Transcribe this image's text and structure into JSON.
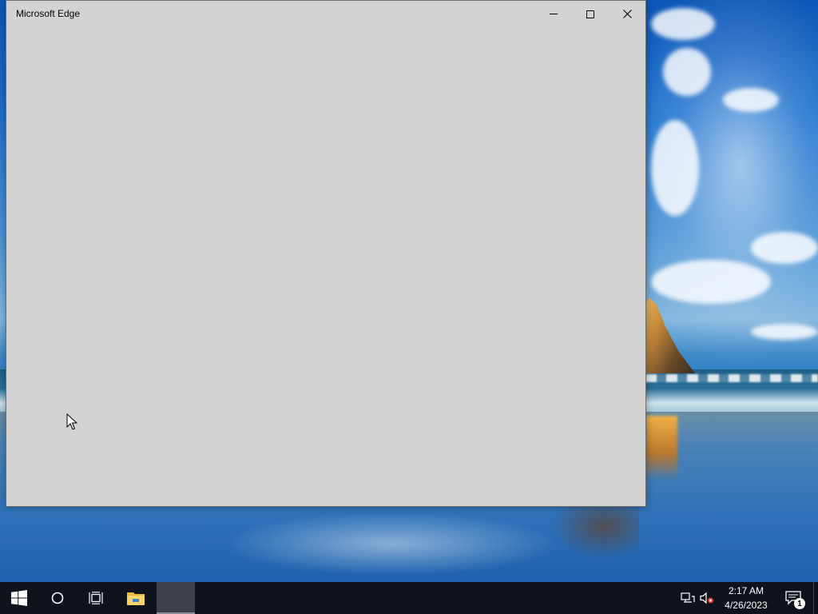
{
  "window": {
    "title": "Microsoft Edge",
    "background_color": "#d3d3d3"
  },
  "title_bar_buttons": [
    {
      "name": "minimize",
      "icon": "minimize-icon"
    },
    {
      "name": "maximize",
      "icon": "maximize-icon"
    },
    {
      "name": "close",
      "icon": "close-icon"
    }
  ],
  "taskbar": {
    "background_color": "#0f141c",
    "items": [
      {
        "name": "start",
        "icon": "windows-logo-icon"
      },
      {
        "name": "search",
        "icon": "cortana-circle-icon"
      },
      {
        "name": "task_view",
        "icon": "task-view-icon"
      },
      {
        "name": "file_explorer",
        "icon": "folder-icon"
      },
      {
        "name": "edge",
        "icon": "edge-app-icon",
        "active": true
      }
    ],
    "tray": {
      "network_icon": "network-disconnected-icon",
      "volume_icon": "volume-muted-icon",
      "time": "2:17 AM",
      "date": "4/26/2023",
      "notifications_icon": "action-center-icon",
      "notification_count": "1"
    }
  }
}
